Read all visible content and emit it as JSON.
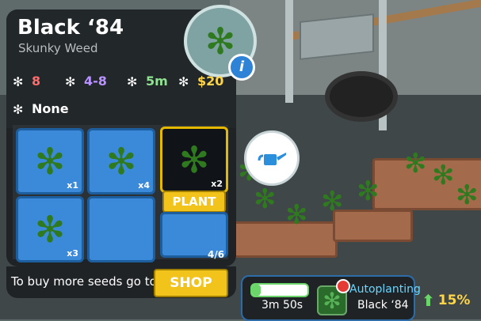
{
  "seed_panel": {
    "name": "Black ‘84",
    "type": "Skunky Weed",
    "stats": {
      "stat1": "8",
      "stat2": "4-8",
      "stat3": "5m",
      "stat4": "$20",
      "special": "None"
    },
    "slots": [
      {
        "count": "x1"
      },
      {
        "count": "x4"
      },
      {
        "count": "x2"
      },
      {
        "count": "x3"
      }
    ],
    "plant_label": "PLANT",
    "capacity": "4/6",
    "buy_text": "To buy more seeds go to",
    "shop_label": "SHOP"
  },
  "autoplanting": {
    "label": "Autoplanting",
    "strain": "Black ‘84",
    "time": "3m 50s",
    "progress": 0.15
  },
  "growth": {
    "percent": "15%"
  },
  "colors": {
    "yellow": "#f2c31b",
    "blue": "#3a8ad9",
    "green": "#6ad66a",
    "red": "#e53935"
  }
}
